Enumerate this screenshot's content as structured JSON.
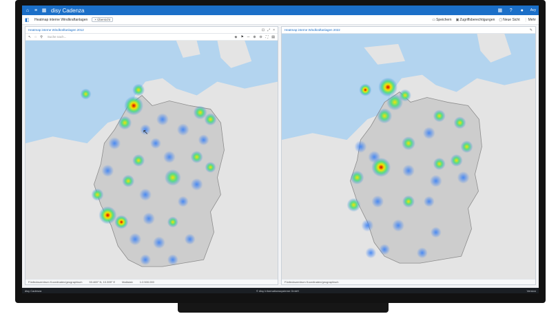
{
  "app": {
    "brand": "disy Cadenza",
    "title_icons": [
      "home-icon",
      "menu-icon",
      "grid-icon"
    ],
    "right_icons": [
      "apps-icon",
      "help-icon",
      "user-icon"
    ],
    "user": "Avy"
  },
  "toolbar": {
    "breadcrumb": "Heatmap interne Windkraftanlagen",
    "chip": "× Übersicht",
    "actions": [
      "Speichern",
      "Zugriffsberechtigungen",
      "Neue Sicht",
      "Mehr"
    ]
  },
  "panels": [
    {
      "title": "Heatmap interne Windkraftanlagen 2012",
      "search_placeholder": "Suche nach...",
      "status": [
        "Fünfeckszentrum Koordinaten/geographisch",
        "53.465° N, 10.395° E",
        "Maßstab",
        "1:2.500.000"
      ]
    },
    {
      "title": "Heatmap interne Windkraftanlagen 2022",
      "status": [
        "Fünfeckszentrum Koordinaten/geographisch"
      ]
    }
  ],
  "bottombar": {
    "left": "disy Cadenza",
    "center": "© disy Informationssysteme GmbH",
    "right": "Version"
  },
  "colors": {
    "brand": "#1b6fc8",
    "land": "#e3e3e3",
    "germany": "#cfcfcf",
    "water": "#b3d4ef"
  }
}
